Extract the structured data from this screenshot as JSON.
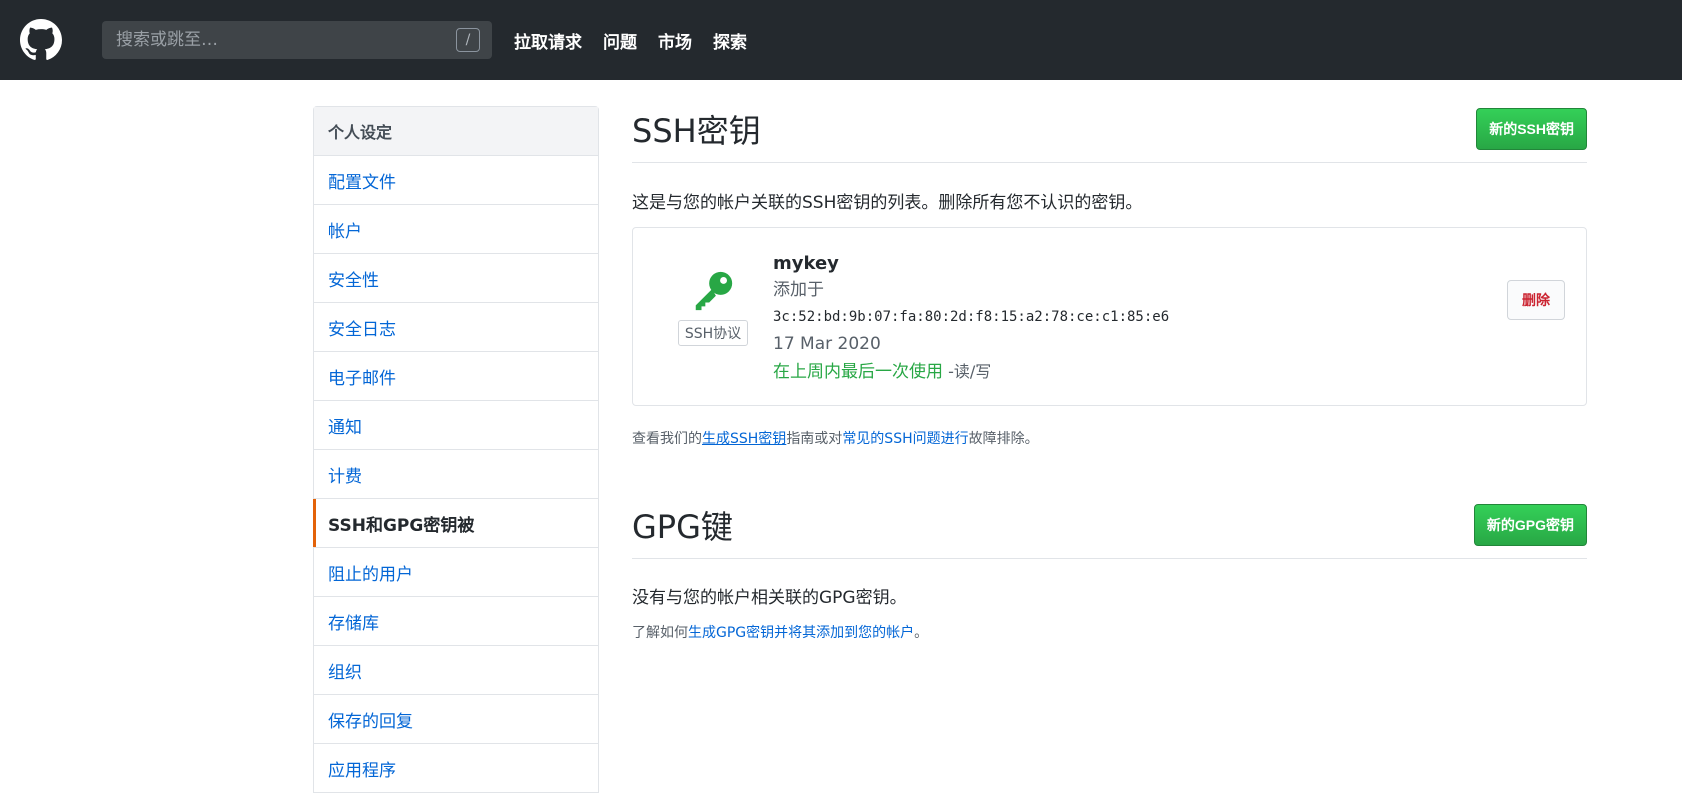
{
  "header": {
    "search_placeholder": "搜索或跳至…",
    "search_shortcut": "/",
    "nav": [
      "拉取请求",
      "问题",
      "市场",
      "探索"
    ]
  },
  "sidebar": {
    "title": "个人设定",
    "items": [
      {
        "label": "配置文件"
      },
      {
        "label": "帐户"
      },
      {
        "label": "安全性"
      },
      {
        "label": "安全日志"
      },
      {
        "label": "电子邮件"
      },
      {
        "label": "通知"
      },
      {
        "label": "计费"
      },
      {
        "label": "SSH和GPG密钥被"
      },
      {
        "label": "阻止的用户"
      },
      {
        "label": "存储库"
      },
      {
        "label": "组织"
      },
      {
        "label": "保存的回复"
      },
      {
        "label": "应用程序"
      }
    ],
    "selected_index": 7
  },
  "ssh": {
    "title": "SSH密钥",
    "new_button": "新的SSH密钥",
    "description": "这是与您的帐户关联的SSH密钥的列表。删除所有您不认识的密钥。",
    "key": {
      "protocol_badge": "SSH协议",
      "name": "mykey",
      "added_label": "添加于",
      "fingerprint": "3c:52:bd:9b:07:fa:80:2d:f8:15:a2:78:ce:c1:85:e6",
      "date": "17 Mar 2020",
      "last_used": "在上周内最后一次使用",
      "access": " -读/写",
      "delete_button": "删除"
    },
    "help": {
      "prefix": "查看我们的",
      "link1": "生成SSH密钥",
      "middle": "指南或对",
      "link2": "常见的SSH问题进行",
      "suffix": "故障排除。"
    }
  },
  "gpg": {
    "title": "GPG键",
    "new_button": "新的GPG密钥",
    "empty": "没有与您的帐户相关联的GPG密钥。",
    "help": {
      "prefix": "了解如何",
      "link": "生成GPG密钥并将其添加到您的帐户",
      "suffix": "。"
    }
  },
  "colors": {
    "header_bg": "#24292e",
    "link": "#0366d6",
    "green": "#28a745",
    "danger": "#cb2431",
    "selected_accent": "#e36209"
  },
  "icons": {
    "logo": "github-octocat-icon",
    "key": "key-icon"
  }
}
